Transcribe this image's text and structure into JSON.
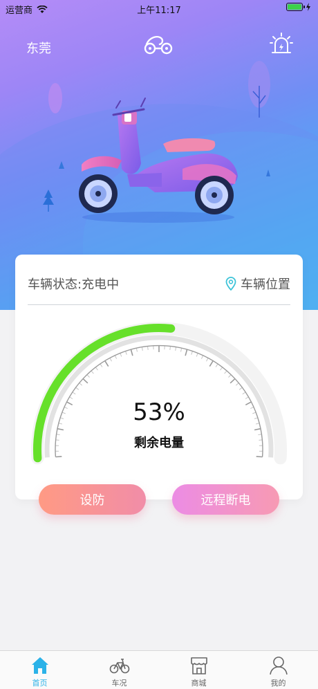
{
  "status_bar": {
    "carrier": "运营商",
    "time": "上午11:17"
  },
  "header": {
    "city": "东莞"
  },
  "card": {
    "status_text": "车辆状态:充电中",
    "location_label": "车辆位置",
    "battery_percent_text": "53%",
    "battery_level": 53,
    "battery_label": "剩余电量"
  },
  "actions": {
    "arm_label": "设防",
    "remote_cut_label": "远程断电"
  },
  "tabs": [
    {
      "label": "首页",
      "icon": "home-icon",
      "active": true
    },
    {
      "label": "车况",
      "icon": "bicycle-icon",
      "active": false
    },
    {
      "label": "商城",
      "icon": "store-icon",
      "active": false
    },
    {
      "label": "我的",
      "icon": "user-icon",
      "active": false
    }
  ],
  "colors": {
    "accent": "#2bb2e8",
    "gauge_fill": "#66e02a",
    "gradient_start": "#b58cf7",
    "gradient_end": "#38c6f2"
  }
}
